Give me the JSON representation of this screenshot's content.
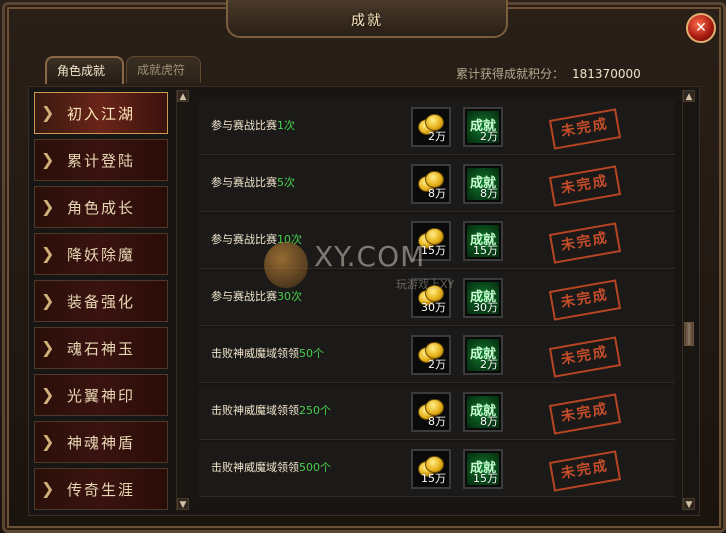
{
  "window": {
    "title": "成就",
    "close_icon": "close-icon"
  },
  "tabs": [
    {
      "label": "角色成就",
      "active": true
    },
    {
      "label": "成就虎符",
      "active": false
    }
  ],
  "score": {
    "label": "累计获得成就积分：",
    "value": "181370000"
  },
  "menu": [
    {
      "label": "初入江湖",
      "active": true
    },
    {
      "label": "累计登陆",
      "active": false
    },
    {
      "label": "角色成长",
      "active": false
    },
    {
      "label": "降妖除魔",
      "active": false
    },
    {
      "label": "装备强化",
      "active": false
    },
    {
      "label": "魂石神玉",
      "active": false
    },
    {
      "label": "光翼神印",
      "active": false
    },
    {
      "label": "神魂神盾",
      "active": false
    },
    {
      "label": "传奇生涯",
      "active": false
    }
  ],
  "rows": [
    {
      "desc": "参与赛战比赛",
      "num": "1次",
      "coin": "2万",
      "badge_label": "成就",
      "badge_qty": "2万",
      "status": "未完成"
    },
    {
      "desc": "参与赛战比赛",
      "num": "5次",
      "coin": "8万",
      "badge_label": "成就",
      "badge_qty": "8万",
      "status": "未完成"
    },
    {
      "desc": "参与赛战比赛",
      "num": "10次",
      "coin": "15万",
      "badge_label": "成就",
      "badge_qty": "15万",
      "status": "未完成"
    },
    {
      "desc": "参与赛战比赛",
      "num": "30次",
      "coin": "30万",
      "badge_label": "成就",
      "badge_qty": "30万",
      "status": "未完成"
    },
    {
      "desc": "击败神威魔域领领",
      "num": "50个",
      "coin": "2万",
      "badge_label": "成就",
      "badge_qty": "2万",
      "status": "未完成"
    },
    {
      "desc": "击败神威魔域领领",
      "num": "250个",
      "coin": "8万",
      "badge_label": "成就",
      "badge_qty": "8万",
      "status": "未完成"
    },
    {
      "desc": "击败神威魔域领领",
      "num": "500个",
      "coin": "15万",
      "badge_label": "成就",
      "badge_qty": "15万",
      "status": "未完成"
    }
  ],
  "watermark": {
    "text": "XY.COM",
    "sub": "玩游戏上XY"
  },
  "scroll": {
    "up_icon": "arrow-up-icon",
    "down_icon": "arrow-down-icon"
  }
}
